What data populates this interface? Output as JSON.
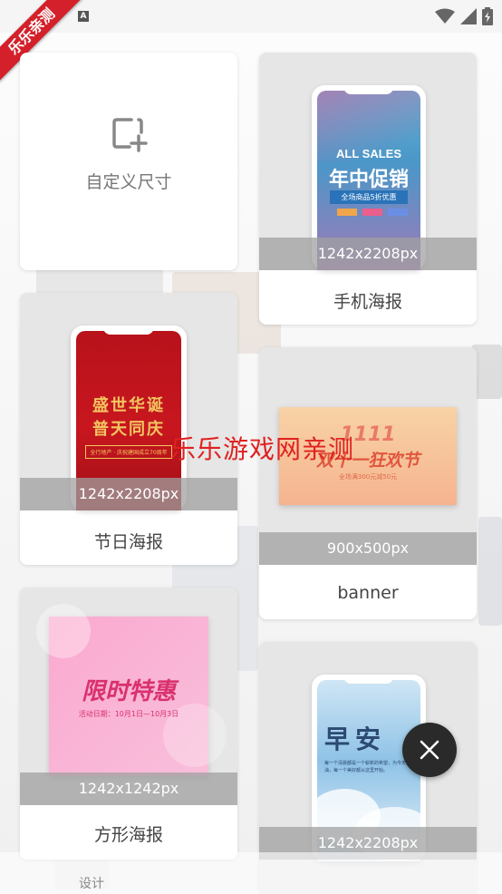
{
  "status_bar": {
    "notification_icon": "a-icon",
    "notification_letter": "A",
    "icons": [
      "wifi-icon",
      "signal-icon",
      "battery-icon"
    ]
  },
  "ribbon": {
    "text": "乐乐亲测"
  },
  "custom_card": {
    "label": "自定义尺寸",
    "icon": "add-crop-icon"
  },
  "templates": [
    {
      "id": "phone-poster",
      "label": "手机海报",
      "size": "1242x2208px",
      "preview": {
        "line1": "ALL SALES",
        "line2": "年中促销",
        "line3": "全场商品5折优惠"
      }
    },
    {
      "id": "holiday-poster",
      "label": "节日海报",
      "size": "1242x2208px",
      "preview": {
        "line1": "盛世华诞",
        "line2": "普天同庆",
        "line3": "全行地产 · 庆祝建国成立70周年"
      }
    },
    {
      "id": "banner",
      "label": "banner",
      "size": "900x500px",
      "preview": {
        "line1": "双十一狂欢节",
        "line2": "1111",
        "line3": "全场满300元减50元"
      }
    },
    {
      "id": "square-poster",
      "label": "方形海报",
      "size": "1242x1242px",
      "preview": {
        "line1": "限时特惠",
        "line2": "活动日期：10月1日—10月3日"
      }
    },
    {
      "id": "morning-poster",
      "label": "",
      "size": "1242x2208px",
      "preview": {
        "line1": "早安",
        "line2": "每一个清晨都是一个崭新的希望，为今天加油，每一个美好都从这里开始。"
      }
    }
  ],
  "watermark": "乐乐游戏网亲测",
  "fab": {
    "icon": "close-icon"
  },
  "bottom_nav": {
    "label": "设计"
  }
}
